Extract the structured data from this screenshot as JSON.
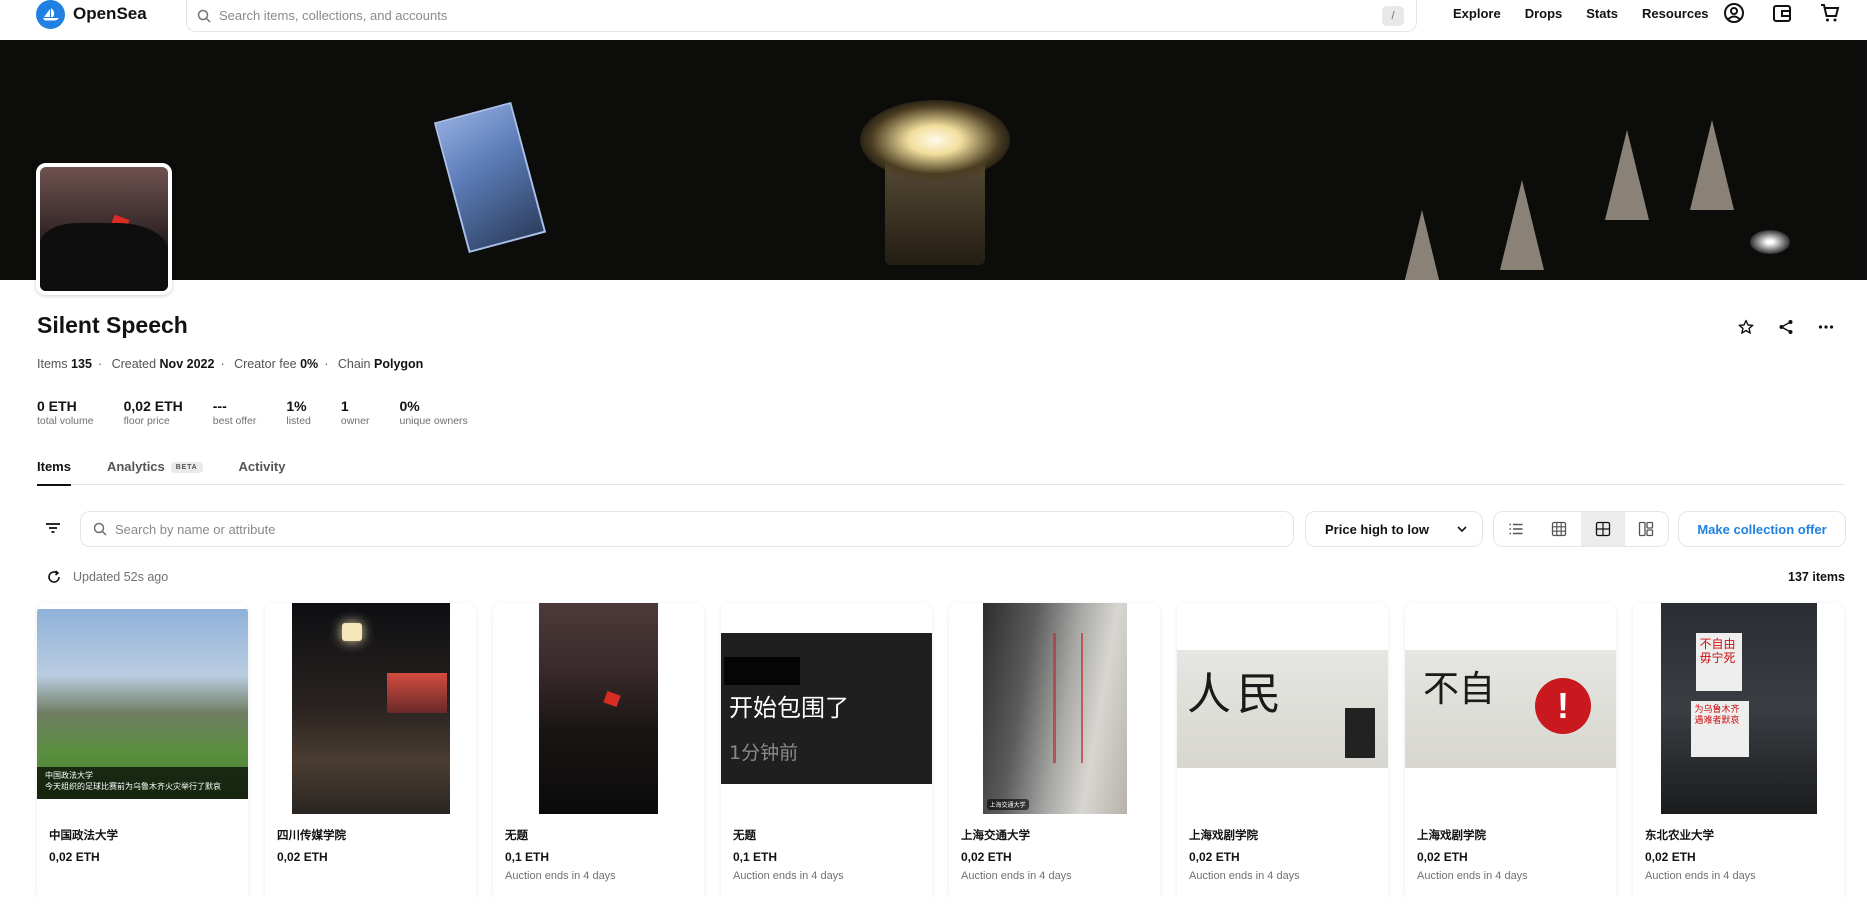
{
  "nav": {
    "brand": "OpenSea",
    "search_placeholder": "Search items, collections, and accounts",
    "search_shortcut": "/",
    "links": [
      "Explore",
      "Drops",
      "Stats",
      "Resources"
    ]
  },
  "collection": {
    "title": "Silent Speech",
    "meta": {
      "items_label": "Items",
      "items_value": "135",
      "created_label": "Created",
      "created_value": "Nov 2022",
      "fee_label": "Creator fee",
      "fee_value": "0%",
      "chain_label": "Chain",
      "chain_value": "Polygon"
    },
    "stats": [
      {
        "value": "0 ETH",
        "label": "total volume"
      },
      {
        "value": "0,02 ETH",
        "label": "floor price"
      },
      {
        "value": "---",
        "label": "best offer"
      },
      {
        "value": "1%",
        "label": "listed"
      },
      {
        "value": "1",
        "label": "owner"
      },
      {
        "value": "0%",
        "label": "unique owners"
      }
    ]
  },
  "tabs": {
    "items": "Items",
    "analytics": "Analytics",
    "analytics_badge": "BETA",
    "activity": "Activity"
  },
  "toolbar": {
    "search_placeholder": "Search by name or attribute",
    "sort_label": "Price high to low",
    "offer_label": "Make collection offer",
    "updated": "Updated 52s ago",
    "count": "137 items"
  },
  "cards": [
    {
      "name": "中国政法大学",
      "price": "0,02 ETH",
      "auction": "",
      "caption_line1": "中国政法大学",
      "caption_line2": "今天组织的足球比赛前为乌鲁木齐火灾举行了默哀"
    },
    {
      "name": "四川传媒学院",
      "price": "0,02 ETH",
      "auction": ""
    },
    {
      "name": "无题",
      "price": "0,1 ETH",
      "auction": "Auction ends in 4 days"
    },
    {
      "name": "无题",
      "price": "0,1 ETH",
      "auction": "Auction ends in 4 days",
      "image_text1": "开始包围了",
      "image_text2": "1分钟前"
    },
    {
      "name": "上海交通大学",
      "price": "0,02 ETH",
      "auction": "Auction ends in 4 days",
      "image_caption": "上海交通大学"
    },
    {
      "name": "上海戏剧学院",
      "price": "0,02 ETH",
      "auction": "Auction ends in 4 days"
    },
    {
      "name": "上海戏剧学院",
      "price": "0,02 ETH",
      "auction": "Auction ends in 4 days"
    },
    {
      "name": "东北农业大学",
      "price": "0,02 ETH",
      "auction": "Auction ends in 4 days"
    }
  ],
  "colors": {
    "accent": "#2081e2",
    "text": "#121212",
    "muted": "#707070",
    "border": "#e5e5e5"
  }
}
